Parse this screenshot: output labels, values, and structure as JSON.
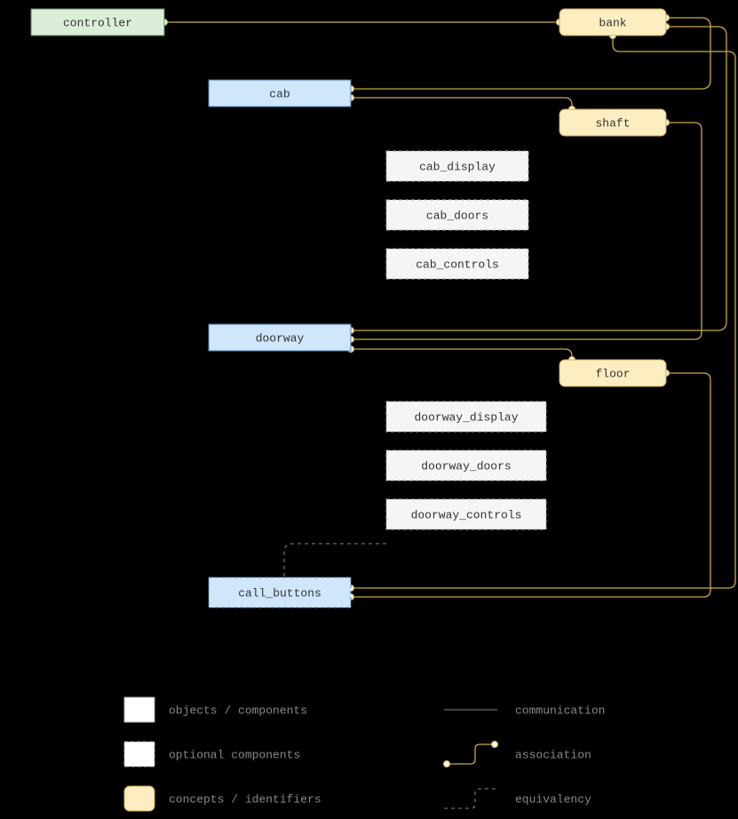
{
  "nodes": {
    "controller": "controller",
    "bank": "bank",
    "cab": "cab",
    "shaft": "shaft",
    "cab_display": "cab_display",
    "cab_doors": "cab_doors",
    "cab_controls": "cab_controls",
    "doorway": "doorway",
    "floor": "floor",
    "doorway_display": "doorway_display",
    "doorway_doors": "doorway_doors",
    "doorway_controls": "doorway_controls",
    "call_buttons": "call_buttons"
  },
  "legend": {
    "objects": "objects / components",
    "optional": "optional components",
    "concepts": "concepts / identifiers",
    "communication": "communication",
    "association": "association",
    "equivalency": "equivalency"
  }
}
